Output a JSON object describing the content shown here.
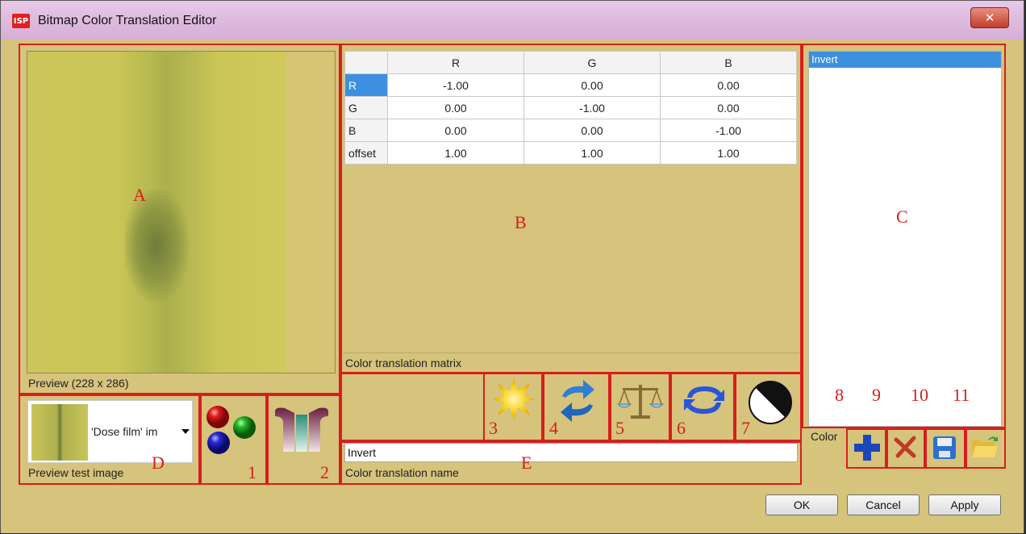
{
  "window": {
    "title": "Bitmap Color Translation Editor",
    "app_icon_text": "ISP",
    "close_symbol": "✕"
  },
  "preview": {
    "label": "Preview (228 x 286)"
  },
  "matrix": {
    "columns": [
      "R",
      "G",
      "B"
    ],
    "rows": [
      {
        "label": "R",
        "values": [
          "-1.00",
          "0.00",
          "0.00"
        ]
      },
      {
        "label": "G",
        "values": [
          "0.00",
          "-1.00",
          "0.00"
        ]
      },
      {
        "label": "B",
        "values": [
          "0.00",
          "0.00",
          "-1.00"
        ]
      },
      {
        "label": "offset",
        "values": [
          "1.00",
          "1.00",
          "1.00"
        ]
      }
    ],
    "caption": "Color translation matrix"
  },
  "translations_list": {
    "items": [
      "Invert"
    ]
  },
  "test_image": {
    "selected": "'Dose film' im",
    "label": "Preview test image"
  },
  "name": {
    "value": "Invert",
    "label": "Color translation name"
  },
  "color_label": "Color",
  "annotations": {
    "letters": [
      "A",
      "B",
      "C",
      "D",
      "E"
    ],
    "numbers": [
      "1",
      "2",
      "3",
      "4",
      "5",
      "6",
      "7",
      "8",
      "9",
      "10",
      "11"
    ]
  },
  "footer": {
    "ok": "OK",
    "cancel": "Cancel",
    "apply": "Apply"
  },
  "icons": {
    "rgb": "rgb-balls-icon",
    "curve": "curve-icon",
    "brightness": "starburst-icon",
    "swap": "swap-arrows-icon",
    "balance": "balance-scale-icon",
    "rotate": "rotate-arrows-icon",
    "contrast": "contrast-icon",
    "add": "plus-icon",
    "delete": "delete-icon",
    "save": "save-icon",
    "open": "folder-open-icon"
  }
}
